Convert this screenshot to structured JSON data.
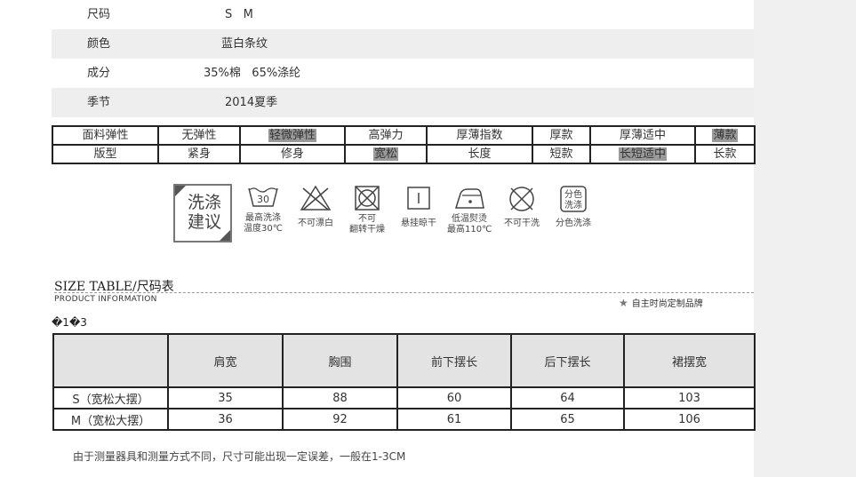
{
  "info_rows": [
    {
      "label": "尺码",
      "value": "S   M"
    },
    {
      "label": "颜色",
      "value": "蓝白条纹"
    },
    {
      "label": "成分",
      "value": "35%棉   65%涤纶"
    },
    {
      "label": "季节",
      "value": "2014夏季"
    }
  ],
  "attributes": {
    "row1": [
      "面料弹性",
      "无弹性",
      "轻微弹性",
      "高弹力",
      "厚薄指数",
      "厚款",
      "厚薄适中",
      "薄款"
    ],
    "row2": [
      "版型",
      "紧身",
      "修身",
      "宽松",
      "长度",
      "短款",
      "长短适中",
      "长款"
    ]
  },
  "care": {
    "box_title_1": "洗涤",
    "box_title_2": "建议",
    "box_prefix_1": "洗",
    "box_prefix_2": "建",
    "box_rest_1": "涤",
    "box_rest_2": "议",
    "items": [
      {
        "icon": "wash-30-icon",
        "symbol": "30",
        "caption1": "最高洗涤",
        "caption2": "温度30℃"
      },
      {
        "icon": "no-bleach-icon",
        "caption1": "不可漂白",
        "caption2": ""
      },
      {
        "icon": "no-tumble-dry-icon",
        "caption1": "不可",
        "caption2": "翻转干燥"
      },
      {
        "icon": "hang-dry-icon",
        "caption1": "悬挂晾干",
        "caption2": ""
      },
      {
        "icon": "iron-low-icon",
        "caption1": "低温熨烫",
        "caption2": "最高110℃"
      },
      {
        "icon": "no-dry-clean-icon",
        "caption1": "不可干洗",
        "caption2": ""
      },
      {
        "icon": "separate-wash-icon",
        "symbol1": "分色",
        "symbol2": "洗涤",
        "caption1": "分色洗涤",
        "caption2": ""
      }
    ]
  },
  "size_section": {
    "title": "SIZE TABLE/尺码表",
    "subtitle": "PRODUCT  INFORMATION",
    "brand": "自主时尚定制品牌",
    "garbled": "�1�3"
  },
  "size_table": {
    "headers": [
      "",
      "肩宽",
      "胸围",
      "前下摆长",
      "后下摆长",
      "裙摆宽"
    ],
    "rows": [
      [
        "S（宽松大摆）",
        "35",
        "88",
        "60",
        "64",
        "103"
      ],
      [
        "M（宽松大摆）",
        "36",
        "92",
        "61",
        "65",
        "106"
      ]
    ]
  },
  "note": "由于测量器具和测量方式不同，尺寸可能出现一定误差，一般在1-3CM"
}
